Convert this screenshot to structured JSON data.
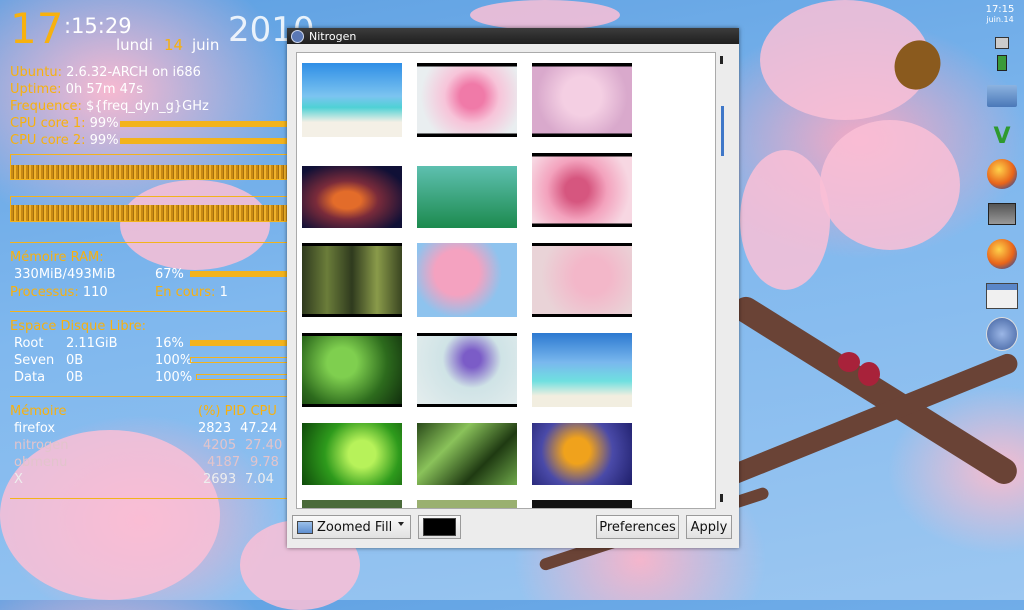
{
  "conky": {
    "hour": "17",
    "minsec": ":15:29",
    "day": "lundi",
    "date": "14",
    "month": "juin",
    "year": "2010",
    "lines": [
      {
        "label": "Ubuntu:",
        "value": "2.6.32-ARCH on i686"
      },
      {
        "label": "Uptime:",
        "value": "0h 57m 47s"
      },
      {
        "label": "Frequence:",
        "value": "${freq_dyn_g}GHz"
      },
      {
        "label": "CPU core 1:",
        "value": "99%",
        "level": 0.99
      },
      {
        "label": "CPU core 2:",
        "value": "99%",
        "level": 0.99
      }
    ],
    "memory_label": "Mémoire RAM:",
    "memory_value": "330MiB/493MiB",
    "memory_pct": "67%",
    "memory_level": 0.67,
    "process_label": "Processus:",
    "process_value": "110",
    "running_label": "En cours:",
    "running_value": "1",
    "disk_title": "Espace Disque Libre:",
    "disks": [
      {
        "name": "Root",
        "value": "2.11GiB",
        "pct": "16%",
        "level": 0.84
      },
      {
        "name": "Seven",
        "value": "0B",
        "pct": "100%",
        "level": 0.0
      },
      {
        "name": "Data",
        "value": "0B",
        "pct": "100%",
        "level": 0.0
      }
    ],
    "top_title": "Mémoire",
    "top_cols": "(%) PID   CPU",
    "top_rows": [
      {
        "name": "firefox",
        "pid": "2823",
        "cpu": "47.24"
      },
      {
        "name": "nitrogen",
        "pid": "4205",
        "cpu": "27.40"
      },
      {
        "name": "obmenu",
        "pid": "4187",
        "cpu": "9.78"
      },
      {
        "name": "X",
        "pid": "2693",
        "cpu": "7.04"
      }
    ]
  },
  "nitrogen": {
    "title": "Nitrogen",
    "mode": "Zoomed Fill",
    "bg_color": "#000000",
    "preferences_label": "Preferences",
    "apply_label": "Apply",
    "thumbnails": [
      "beach-hut",
      "pink-blossom",
      "blossom-blur",
      "galaxy",
      "green-grass",
      "pink-flower",
      "bamboo",
      "bee-blossom",
      "pink-soft",
      "green-bamboo",
      "iris",
      "palm-beach",
      "fern",
      "pine",
      "daisy",
      "more-1",
      "more-2",
      "more-3"
    ]
  },
  "dock": {
    "time": "17:15",
    "date": "juin.14",
    "icons": [
      "screen-icon",
      "battery-icon",
      "folder-icon",
      "vim-icon",
      "firefox-icon",
      "monitor-icon",
      "firefox-icon-2",
      "window-icon",
      "openbox-icon"
    ]
  }
}
